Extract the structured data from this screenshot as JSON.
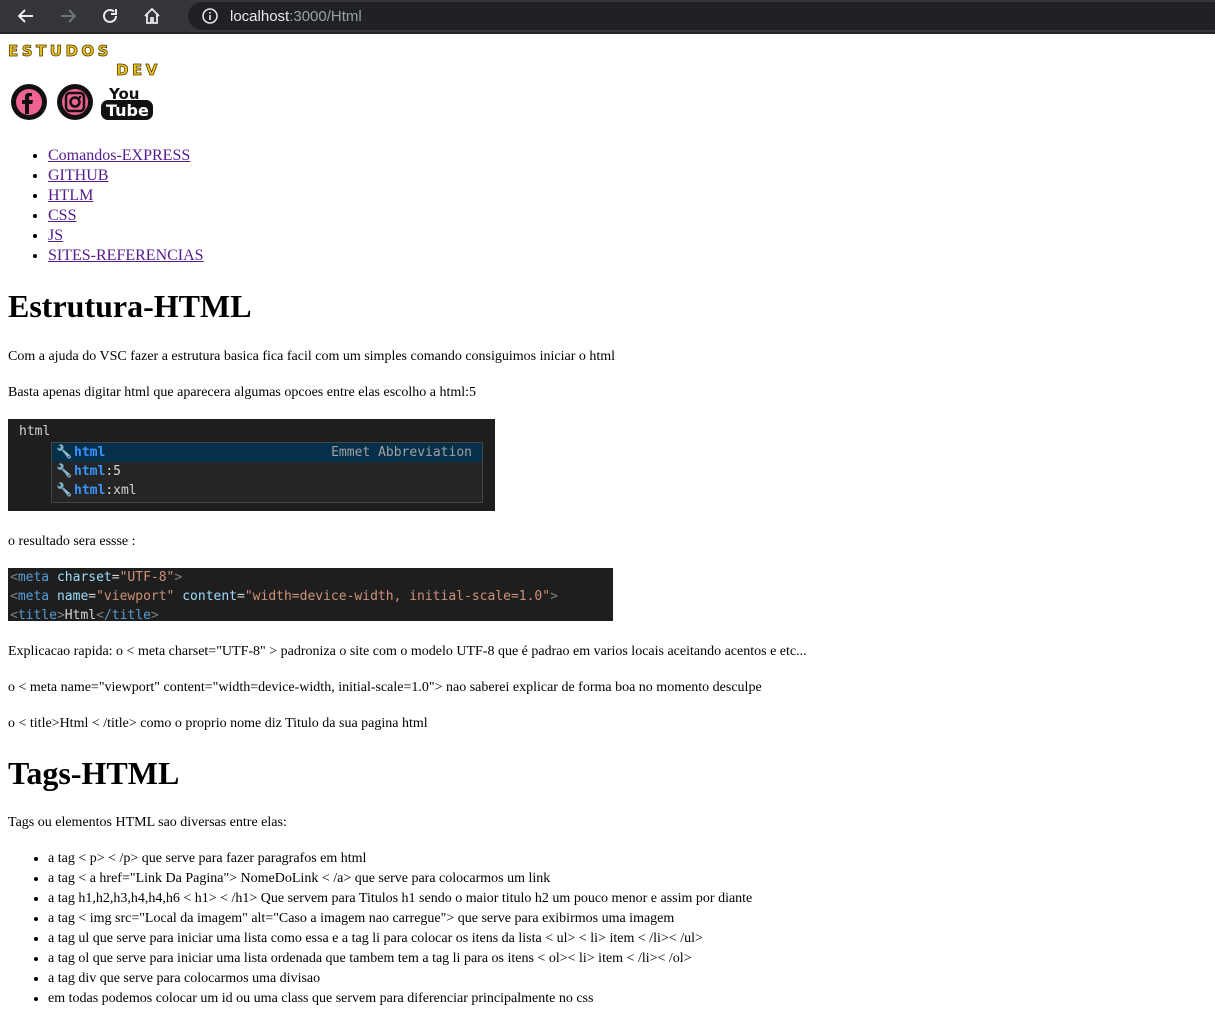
{
  "browser": {
    "url_host": "localhost",
    "url_path": ":3000/Html"
  },
  "logo": {
    "line1": "ESTUDOS",
    "line2": "DEV"
  },
  "social": {
    "youtube_top": "You",
    "youtube_bottom": "Tube"
  },
  "nav": {
    "items": [
      {
        "label": "Comandos-EXPRESS"
      },
      {
        "label": "GITHUB"
      },
      {
        "label": "HTLM"
      },
      {
        "label": "CSS"
      },
      {
        "label": "JS"
      },
      {
        "label": "SITES-REFERENCIAS"
      }
    ]
  },
  "section1": {
    "title": "Estrutura-HTML",
    "p1": "Com a ajuda do VSC fazer a estrutura basica fica facil com um simples comando consiguimos iniciar o html",
    "p2": "Basta apenas digitar html que aparecera algumas opcoes entre elas escolho a html:5",
    "vsc": {
      "typed": "html",
      "suggestions": [
        {
          "bold": "html",
          "rest": "",
          "hint": "Emmet Abbreviation"
        },
        {
          "bold": "html",
          "rest": ":5",
          "hint": ""
        },
        {
          "bold": "html",
          "rest": ":xml",
          "hint": ""
        }
      ]
    },
    "p3": "o resultado sera essse :",
    "code": {
      "l1_tag": "meta",
      "l1_attr": "charset",
      "l1_val": "\"UTF-8\"",
      "l2_tag": "meta",
      "l2_attr1": "name",
      "l2_val1": "\"viewport\"",
      "l2_attr2": "content",
      "l2_val2": "\"width=device-width, initial-scale=1.0\"",
      "l3_tag": "title",
      "l3_text": "Html",
      "l3_close": "/title"
    },
    "p4": "Explicacao rapida: o < meta charset=\"UTF-8\" > padroniza o site com o modelo UTF-8 que é padrao em varios locais aceitando acentos e etc...",
    "p5": "o < meta name=\"viewport\" content=\"width=device-width, initial-scale=1.0\"> nao saberei explicar de forma boa no momento desculpe",
    "p6": "o < title>Html < /title> como o proprio nome diz Titulo da sua pagina html"
  },
  "section2": {
    "title": "Tags-HTML",
    "intro": "Tags ou elementos HTML sao diversas entre elas:",
    "items": [
      {
        "text": "a tag < p> < /p> que serve para fazer paragrafos em html"
      },
      {
        "text": "a tag < a href=\"Link Da Pagina\"> NomeDoLink < /a> que serve para colocarmos um link"
      },
      {
        "text": "a tag h1,h2,h3,h4,h4,h6 < h1> < /h1> Que servem para Titulos h1 sendo o maior titulo h2 um pouco menor e assim por diante"
      },
      {
        "text": "a tag < img src=\"Local da imagem\" alt=\"Caso a imagem nao carregue\"> que serve para exibirmos uma imagem"
      },
      {
        "text": "a tag ul que serve para iniciar uma lista como essa e a tag li para colocar os itens da lista < ul> < li> item < /li>< /ul>"
      },
      {
        "text": "a tag ol que serve para iniciar uma lista ordenada que tambem tem a tag li para os itens < ol>< li> item < /li>< /ol>"
      },
      {
        "text": "a tag div que serve para colocarmos uma divisao"
      },
      {
        "text": "em todas podemos colocar um id ou uma class que servem para diferenciar principalmente no css"
      }
    ]
  },
  "colors": {
    "chrome_bg": "#35363a",
    "omnibox_bg": "#202124",
    "link_visited": "#551a8b",
    "logo_yellow": "#f5c518",
    "vsc_bg": "#1e1e1e",
    "vsc_blue": "#3794ff"
  }
}
